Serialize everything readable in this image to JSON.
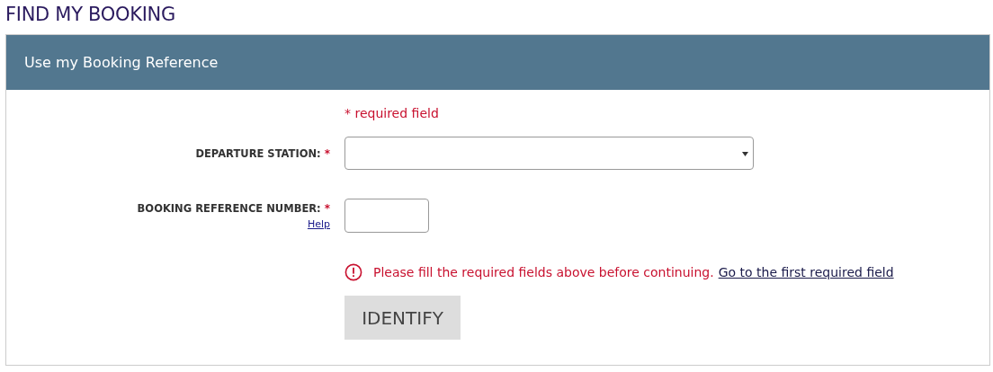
{
  "page_title": "FIND MY BOOKING",
  "panel": {
    "title": "Use my Booking Reference",
    "required_note": "* required field",
    "fields": [
      {
        "kind": "select",
        "label": "DEPARTURE STATION:",
        "required_mark": "*"
      },
      {
        "kind": "text",
        "label": "BOOKING REFERENCE NUMBER:",
        "required_mark": "*",
        "help_link": "Help"
      }
    ],
    "error": {
      "message": "Please fill the required fields above before continuing.",
      "link": "Go to the first required field"
    },
    "submit_button": {
      "label": "IDENTIFY",
      "disabled": true
    }
  }
}
